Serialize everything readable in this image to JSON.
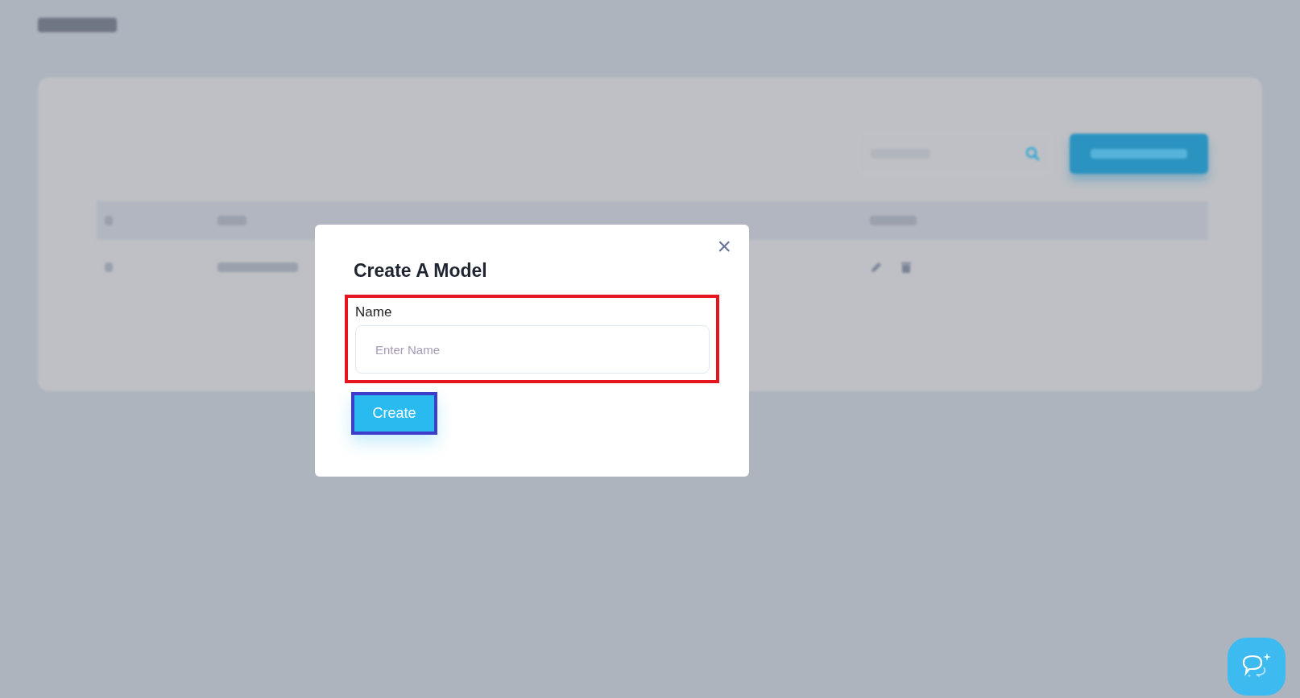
{
  "modal": {
    "title": "Create A Model",
    "close": "×",
    "field": {
      "label": "Name",
      "placeholder": "Enter Name",
      "highlighted": true
    },
    "submit": {
      "label": "Create",
      "focused": true
    }
  }
}
